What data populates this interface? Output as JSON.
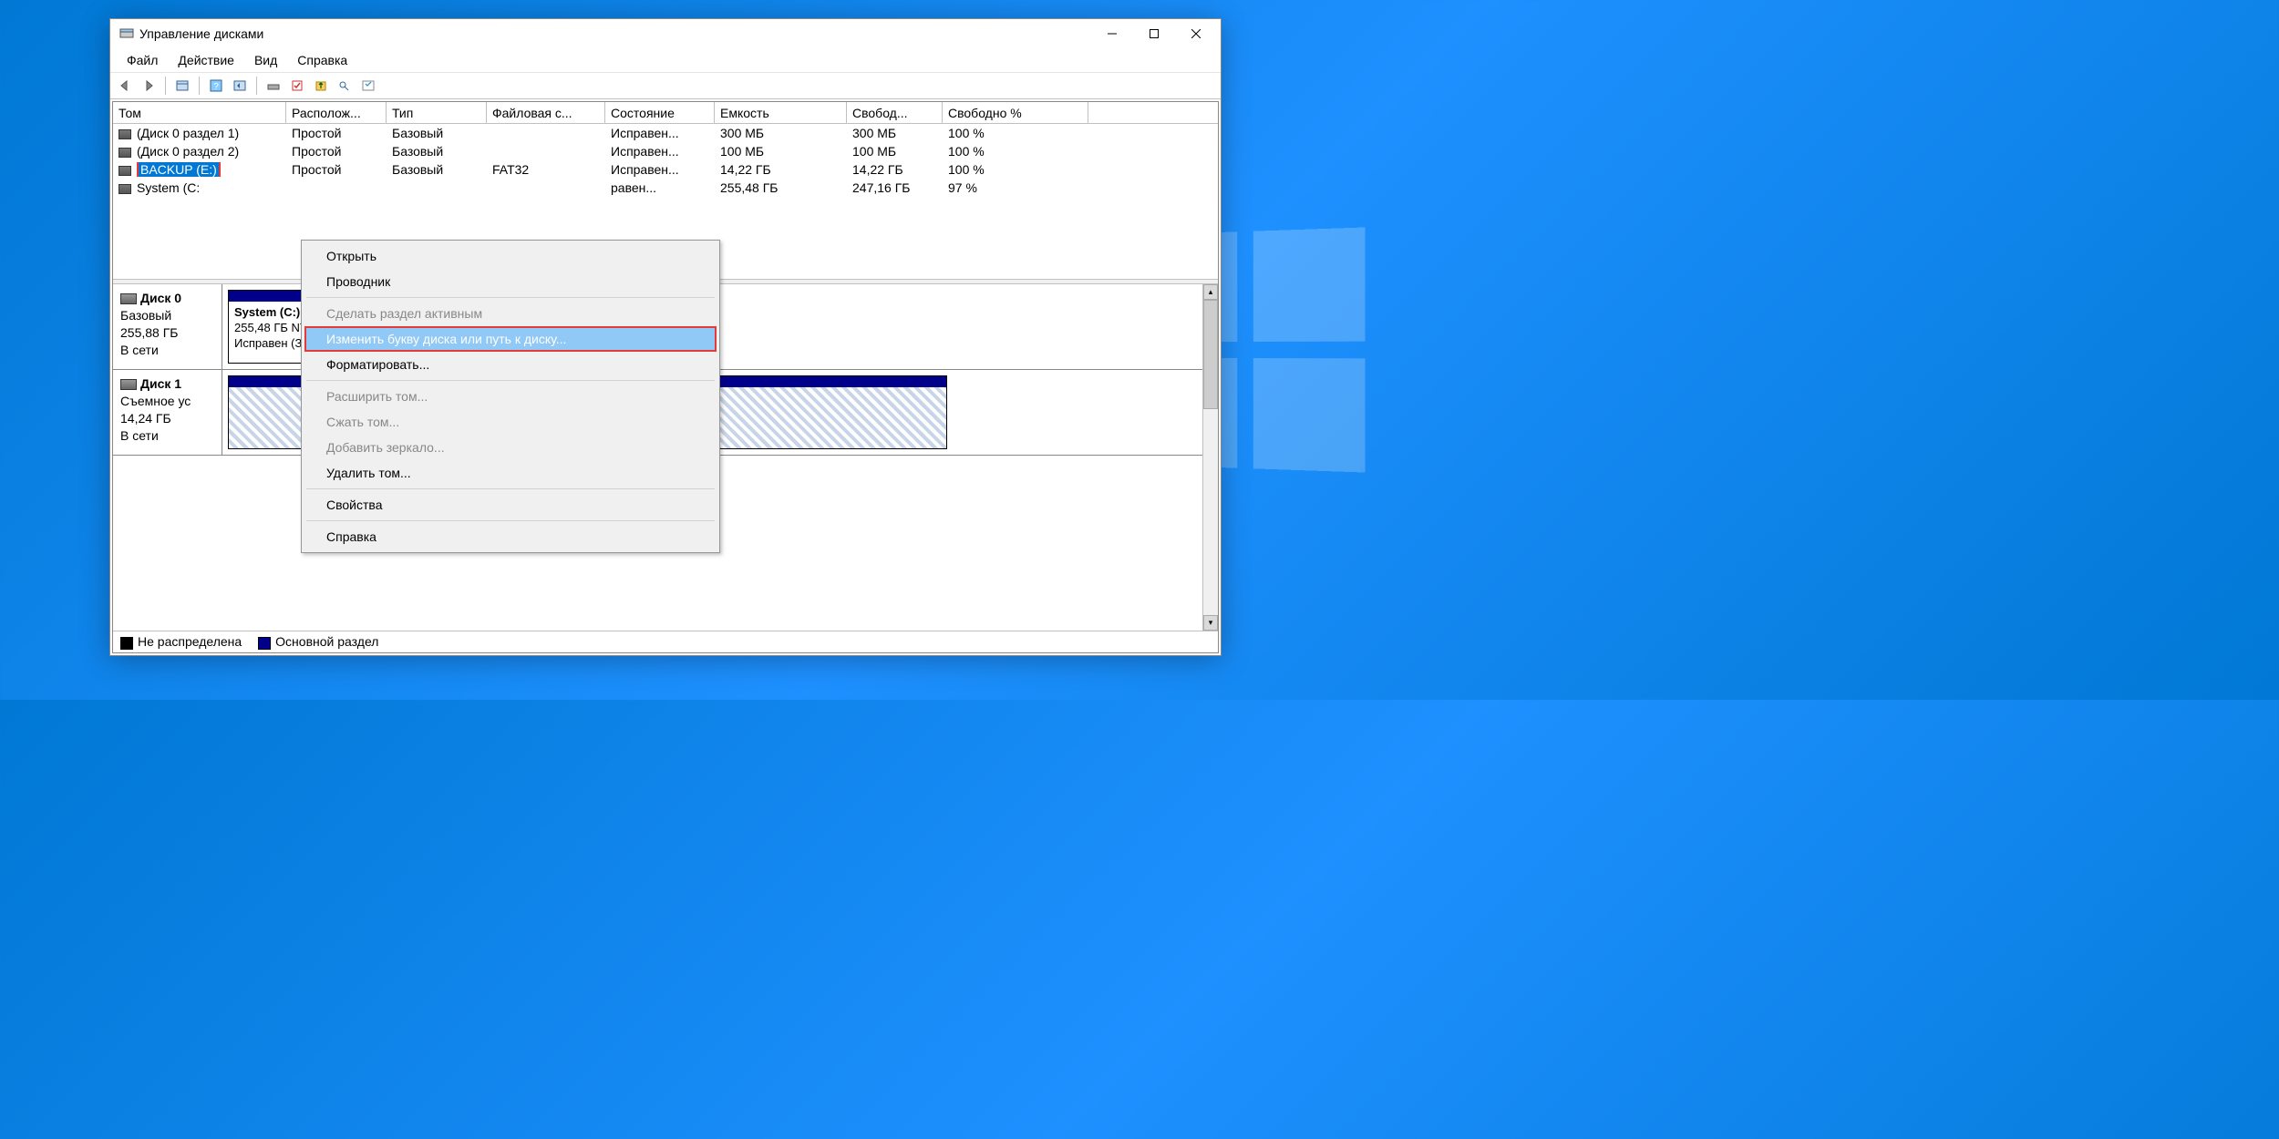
{
  "window": {
    "title": "Управление дисками"
  },
  "menu": {
    "file": "Файл",
    "action": "Действие",
    "view": "Вид",
    "help": "Справка"
  },
  "columns": [
    "Том",
    "Располож...",
    "Тип",
    "Файловая с...",
    "Состояние",
    "Емкость",
    "Свобод...",
    "Свободно %"
  ],
  "volumes": [
    {
      "name": "(Диск 0 раздел 1)",
      "layout": "Простой",
      "type": "Базовый",
      "fs": "",
      "status": "Исправен...",
      "cap": "300 МБ",
      "free": "300 МБ",
      "pct": "100 %"
    },
    {
      "name": "(Диск 0 раздел 2)",
      "layout": "Простой",
      "type": "Базовый",
      "fs": "",
      "status": "Исправен...",
      "cap": "100 МБ",
      "free": "100 МБ",
      "pct": "100 %"
    },
    {
      "name": "BACKUP (E:)",
      "layout": "Простой",
      "type": "Базовый",
      "fs": "FAT32",
      "status": "Исправен...",
      "cap": "14,22 ГБ",
      "free": "14,22 ГБ",
      "pct": "100 %",
      "selected": true
    },
    {
      "name": "System (C:",
      "layout": "",
      "type": "",
      "fs": "",
      "status": "равен...",
      "cap": "255,48 ГБ",
      "free": "247,16 ГБ",
      "pct": "97 %"
    }
  ],
  "ctx": {
    "open": "Открыть",
    "explorer": "Проводник",
    "active": "Сделать раздел активным",
    "change": "Изменить букву диска или путь к диску...",
    "format": "Форматировать...",
    "extend": "Расширить том...",
    "shrink": "Сжать том...",
    "mirror": "Добавить зеркало...",
    "delete": "Удалить том...",
    "props": "Свойства",
    "help": "Справка"
  },
  "disk0": {
    "label": "Диск 0",
    "type": "Базовый",
    "size": "255,88 ГБ",
    "status": "В сети",
    "part": {
      "title": "System  (C:)",
      "line1": "255,48 ГБ NTFS",
      "line2": "Исправен (Загрузка, Файл подкачки, Аварийный дамп па"
    }
  },
  "disk1": {
    "label": "Диск 1",
    "type": "Съемное ус",
    "size": "14,24 ГБ",
    "status": "В сети"
  },
  "legend": {
    "unalloc": "Не распределена",
    "primary": "Основной раздел"
  }
}
